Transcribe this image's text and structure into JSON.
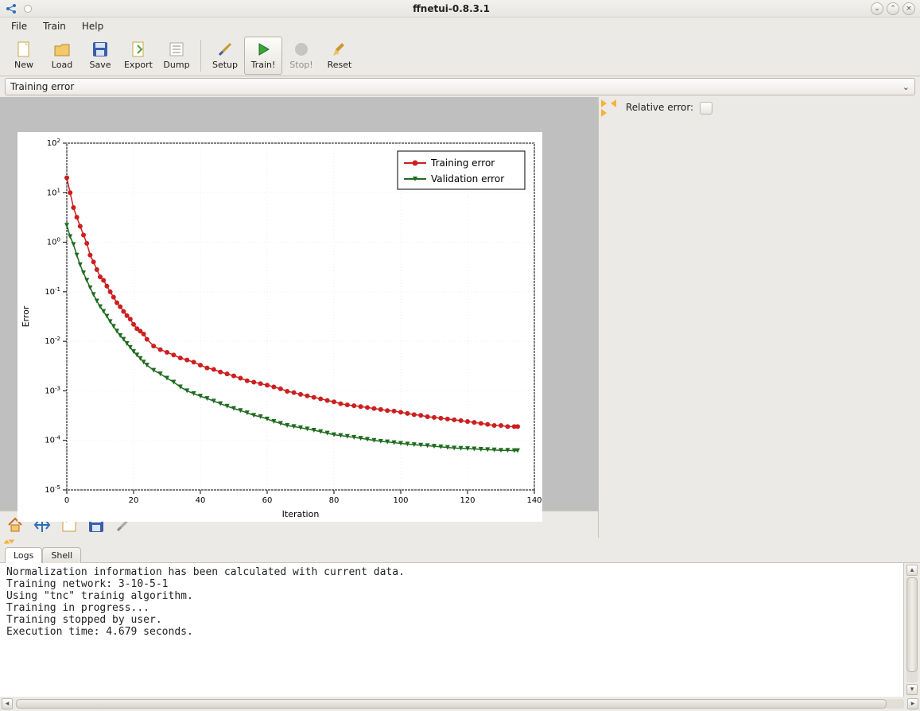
{
  "window": {
    "title": "ffnetui-0.8.3.1"
  },
  "menubar": {
    "items": [
      "File",
      "Train",
      "Help"
    ]
  },
  "toolbar": {
    "items": [
      {
        "id": "new",
        "label": "New"
      },
      {
        "id": "load",
        "label": "Load"
      },
      {
        "id": "save",
        "label": "Save"
      },
      {
        "id": "export",
        "label": "Export"
      },
      {
        "id": "dump",
        "label": "Dump"
      },
      {
        "id": "sep"
      },
      {
        "id": "setup",
        "label": "Setup"
      },
      {
        "id": "train",
        "label": "Train!",
        "active": true
      },
      {
        "id": "stop",
        "label": "Stop!",
        "disabled": true
      },
      {
        "id": "reset",
        "label": "Reset"
      }
    ]
  },
  "selector": {
    "value": "Training error"
  },
  "side": {
    "relative_error_label": "Relative error:"
  },
  "tabs": {
    "items": [
      "Logs",
      "Shell"
    ],
    "active": 0
  },
  "console_lines": [
    "Normalization information has been calculated with current data.",
    "Training network: 3-10-5-1",
    "Using \"tnc\" trainig algorithm.",
    "Training in progress...",
    "Training stopped by user.",
    "Execution time: 4.679 seconds."
  ],
  "chart_data": {
    "type": "line",
    "title": "",
    "xlabel": "Iteration",
    "ylabel": "Error",
    "xlim": [
      0,
      140
    ],
    "xticks": [
      0,
      20,
      40,
      60,
      80,
      100,
      120,
      140
    ],
    "ylog": true,
    "ylim_exp": [
      -5,
      2
    ],
    "yticks_exp": [
      -5,
      -4,
      -3,
      -2,
      -1,
      0,
      1,
      2
    ],
    "legend": [
      "Training error",
      "Validation error"
    ],
    "series": [
      {
        "name": "Training error",
        "color": "#cc1f1f",
        "marker": "circle",
        "values": [
          [
            0,
            20
          ],
          [
            1,
            10
          ],
          [
            2,
            5
          ],
          [
            3,
            3.2
          ],
          [
            4,
            2.1
          ],
          [
            5,
            1.4
          ],
          [
            6,
            0.95
          ],
          [
            7,
            0.55
          ],
          [
            8,
            0.4
          ],
          [
            9,
            0.28
          ],
          [
            10,
            0.2
          ],
          [
            11,
            0.17
          ],
          [
            12,
            0.13
          ],
          [
            13,
            0.1
          ],
          [
            14,
            0.078
          ],
          [
            15,
            0.06
          ],
          [
            16,
            0.05
          ],
          [
            17,
            0.04
          ],
          [
            18,
            0.033
          ],
          [
            19,
            0.028
          ],
          [
            20,
            0.022
          ],
          [
            21,
            0.018
          ],
          [
            22,
            0.016
          ],
          [
            23,
            0.014
          ],
          [
            24,
            0.011
          ],
          [
            26,
            0.008
          ],
          [
            28,
            0.0068
          ],
          [
            30,
            0.006
          ],
          [
            32,
            0.0053
          ],
          [
            34,
            0.0046
          ],
          [
            36,
            0.0042
          ],
          [
            38,
            0.0038
          ],
          [
            40,
            0.0033
          ],
          [
            42,
            0.0029
          ],
          [
            44,
            0.0027
          ],
          [
            46,
            0.0024
          ],
          [
            48,
            0.0022
          ],
          [
            50,
            0.002
          ],
          [
            52,
            0.0018
          ],
          [
            54,
            0.0016
          ],
          [
            56,
            0.0015
          ],
          [
            58,
            0.0014
          ],
          [
            60,
            0.0013
          ],
          [
            62,
            0.0012
          ],
          [
            64,
            0.0011
          ],
          [
            66,
            0.00098
          ],
          [
            68,
            0.00092
          ],
          [
            70,
            0.00085
          ],
          [
            72,
            0.00079
          ],
          [
            74,
            0.00074
          ],
          [
            76,
            0.00069
          ],
          [
            78,
            0.00064
          ],
          [
            80,
            0.0006
          ],
          [
            82,
            0.00055
          ],
          [
            84,
            0.00052
          ],
          [
            86,
            0.0005
          ],
          [
            88,
            0.00048
          ],
          [
            90,
            0.00046
          ],
          [
            92,
            0.00044
          ],
          [
            94,
            0.00042
          ],
          [
            96,
            0.0004
          ],
          [
            98,
            0.00039
          ],
          [
            100,
            0.00037
          ],
          [
            102,
            0.00035
          ],
          [
            104,
            0.00033
          ],
          [
            106,
            0.00032
          ],
          [
            108,
            0.0003
          ],
          [
            110,
            0.00029
          ],
          [
            112,
            0.00028
          ],
          [
            114,
            0.00027
          ],
          [
            116,
            0.00026
          ],
          [
            118,
            0.00025
          ],
          [
            120,
            0.00024
          ],
          [
            122,
            0.00023
          ],
          [
            124,
            0.00022
          ],
          [
            126,
            0.00021
          ],
          [
            128,
            0.0002
          ],
          [
            130,
            0.0002
          ],
          [
            132,
            0.00019
          ],
          [
            134,
            0.00019
          ],
          [
            135,
            0.00019
          ]
        ]
      },
      {
        "name": "Validation error",
        "color": "#1e6b1e",
        "marker": "triangle",
        "values": [
          [
            0,
            2.2
          ],
          [
            1,
            1.3
          ],
          [
            2,
            0.9
          ],
          [
            3,
            0.55
          ],
          [
            4,
            0.35
          ],
          [
            5,
            0.24
          ],
          [
            6,
            0.17
          ],
          [
            7,
            0.12
          ],
          [
            8,
            0.088
          ],
          [
            9,
            0.065
          ],
          [
            10,
            0.05
          ],
          [
            11,
            0.04
          ],
          [
            12,
            0.032
          ],
          [
            13,
            0.025
          ],
          [
            14,
            0.02
          ],
          [
            15,
            0.016
          ],
          [
            16,
            0.013
          ],
          [
            17,
            0.011
          ],
          [
            18,
            0.009
          ],
          [
            19,
            0.0075
          ],
          [
            20,
            0.0062
          ],
          [
            21,
            0.0053
          ],
          [
            22,
            0.0045
          ],
          [
            23,
            0.0038
          ],
          [
            24,
            0.0033
          ],
          [
            26,
            0.0026
          ],
          [
            28,
            0.0022
          ],
          [
            30,
            0.0018
          ],
          [
            32,
            0.0015
          ],
          [
            34,
            0.0012
          ],
          [
            36,
            0.001
          ],
          [
            38,
            0.00088
          ],
          [
            40,
            0.00078
          ],
          [
            42,
            0.0007
          ],
          [
            44,
            0.00062
          ],
          [
            46,
            0.00055
          ],
          [
            48,
            0.00049
          ],
          [
            50,
            0.00044
          ],
          [
            52,
            0.0004
          ],
          [
            54,
            0.00036
          ],
          [
            56,
            0.00032
          ],
          [
            58,
            0.0003
          ],
          [
            60,
            0.00027
          ],
          [
            62,
            0.00024
          ],
          [
            64,
            0.00022
          ],
          [
            66,
            0.0002
          ],
          [
            68,
            0.00019
          ],
          [
            70,
            0.00018
          ],
          [
            72,
            0.00017
          ],
          [
            74,
            0.00016
          ],
          [
            76,
            0.00015
          ],
          [
            78,
            0.00014
          ],
          [
            80,
            0.00013
          ],
          [
            82,
            0.000125
          ],
          [
            84,
            0.00012
          ],
          [
            86,
            0.000115
          ],
          [
            88,
            0.00011
          ],
          [
            90,
            0.000105
          ],
          [
            92,
            0.0001
          ],
          [
            94,
            9.6e-05
          ],
          [
            96,
            9.3e-05
          ],
          [
            98,
            9e-05
          ],
          [
            100,
            8.7e-05
          ],
          [
            102,
            8.4e-05
          ],
          [
            104,
            8.2e-05
          ],
          [
            106,
            8e-05
          ],
          [
            108,
            7.8e-05
          ],
          [
            110,
            7.6e-05
          ],
          [
            112,
            7.4e-05
          ],
          [
            114,
            7.2e-05
          ],
          [
            116,
            7e-05
          ],
          [
            118,
            6.9e-05
          ],
          [
            120,
            6.8e-05
          ],
          [
            122,
            6.7e-05
          ],
          [
            124,
            6.6e-05
          ],
          [
            126,
            6.5e-05
          ],
          [
            128,
            6.4e-05
          ],
          [
            130,
            6.3e-05
          ],
          [
            132,
            6.3e-05
          ],
          [
            134,
            6.2e-05
          ],
          [
            135,
            6.2e-05
          ]
        ]
      }
    ]
  }
}
